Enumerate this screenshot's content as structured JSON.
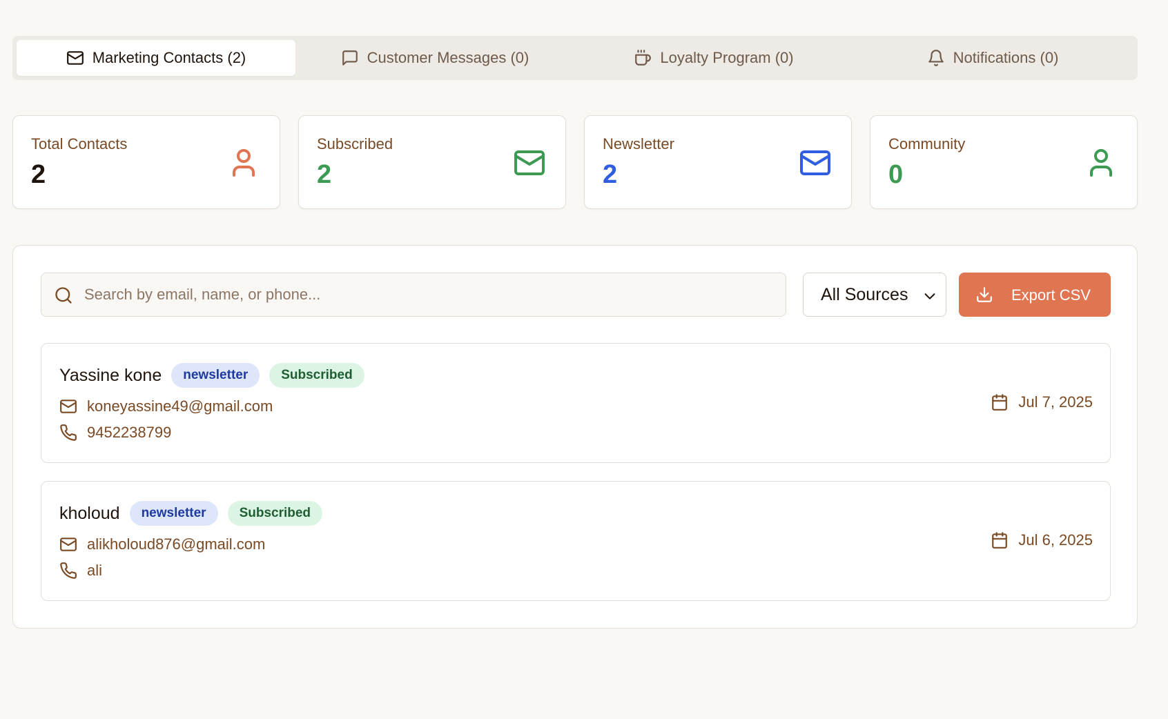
{
  "tabs": [
    {
      "label": "Marketing Contacts (2)",
      "icon": "mail-icon",
      "active": true
    },
    {
      "label": "Customer Messages (0)",
      "icon": "message-square-icon",
      "active": false
    },
    {
      "label": "Loyalty Program (0)",
      "icon": "coffee-icon",
      "active": false
    },
    {
      "label": "Notifications (0)",
      "icon": "bell-icon",
      "active": false
    }
  ],
  "stats": [
    {
      "label": "Total Contacts",
      "value": "2",
      "icon": "user-icon",
      "color": "#e07552",
      "value_color": "#1f140b"
    },
    {
      "label": "Subscribed",
      "value": "2",
      "icon": "mail-icon",
      "color": "#3c9a53",
      "value_color": "#3c9a53"
    },
    {
      "label": "Newsletter",
      "value": "2",
      "icon": "mail-icon",
      "color": "#2f5fe0",
      "value_color": "#2f5fe0"
    },
    {
      "label": "Community",
      "value": "0",
      "icon": "user-icon",
      "color": "#3c9a53",
      "value_color": "#3c9a53"
    }
  ],
  "search": {
    "placeholder": "Search by email, name, or phone...",
    "value": ""
  },
  "source_filter": {
    "selected": "All Sources"
  },
  "export": {
    "label": "Export CSV"
  },
  "contacts": [
    {
      "name": "Yassine kone",
      "source": "newsletter",
      "status": "Subscribed",
      "email": "koneyassine49@gmail.com",
      "phone": "9452238799",
      "date": "Jul 7, 2025"
    },
    {
      "name": "kholoud",
      "source": "newsletter",
      "status": "Subscribed",
      "email": "alikholoud876@gmail.com",
      "phone": "ali",
      "date": "Jul 6, 2025"
    }
  ],
  "colors": {
    "accent": "#e07552",
    "brown_text": "#7a4a25",
    "background": "#f9f8f5"
  }
}
